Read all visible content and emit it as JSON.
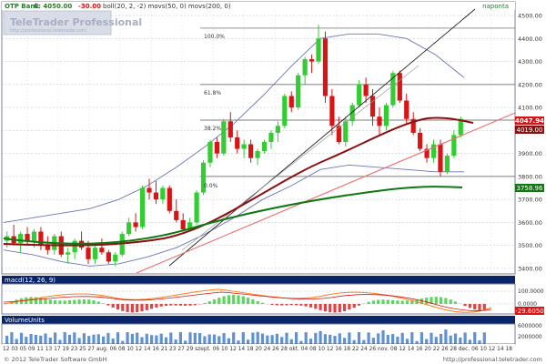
{
  "header": {
    "title": "OTP Bank",
    "close_label": "C: 4050.00",
    "change_label": "-30.00",
    "indicators_label": "boll(20, 2, -2)  movs(50, 0)  movs(200, 0)",
    "period": "naponta"
  },
  "watermark": {
    "name": "TeleTrader Professional",
    "url": "http://professional.teletrader.com"
  },
  "price_axis_ticks": [
    "4500.00",
    "4400.00",
    "4300.00",
    "4200.00",
    "4100.00",
    "4000.00",
    "3900.00",
    "3800.00",
    "3700.00",
    "3600.00",
    "3500.00",
    "3400.00"
  ],
  "price_badges": {
    "last": "4047.94",
    "ma50": "4019.00",
    "ma200": "3758.96"
  },
  "fib_labels": [
    "100.0%",
    "61.8%",
    "38.2%",
    "0.0%"
  ],
  "macd": {
    "title": "macd(12, 26, 9)",
    "ticks": [
      "100.0000",
      "0.0000"
    ],
    "badge": "-29.6050"
  },
  "volume": {
    "title": "VolumeUnits",
    "ticks": [
      "6000000",
      "2000000"
    ]
  },
  "x_axis_labels": "12 03 05 09 11 13 17 19 23 25 27 aug. 06 08 10 12 14 16 21 23 27 29 szept. 06 10 12 14 18 20 24 26 28 okt. 04 08 10 12 16 18 22 24 26 nov. 08 12 14 16 20 22 26 28 dec. 06 10 12 14 18",
  "footer": {
    "copyright": "© 2012 TeleTrader Software GmbH",
    "url": "http://professional.teletrader.com"
  },
  "colors": {
    "background": "#ffffff",
    "grid": "#b8bccd",
    "up": "#33cc33",
    "down": "#d81414",
    "ma50": "#8b1010",
    "ma200": "#107810",
    "panel_bar": "#0a246a"
  },
  "chart_data": {
    "type": "candlestick",
    "title": "OTP Bank",
    "ylim": [
      3380,
      4520
    ],
    "y_ticks": [
      4500,
      4400,
      4300,
      4200,
      4100,
      4000,
      3900,
      3800,
      3700,
      3600,
      3500,
      3400
    ],
    "candles_ohlc_sample": [
      [
        3520,
        3560,
        3490,
        3540
      ],
      [
        3540,
        3590,
        3500,
        3510
      ],
      [
        3510,
        3560,
        3470,
        3550
      ],
      [
        3550,
        3580,
        3500,
        3520
      ],
      [
        3520,
        3570,
        3490,
        3560
      ],
      [
        3560,
        3580,
        3480,
        3500
      ],
      [
        3500,
        3540,
        3460,
        3480
      ],
      [
        3480,
        3550,
        3460,
        3540
      ],
      [
        3540,
        3560,
        3450,
        3460
      ],
      [
        3460,
        3490,
        3420,
        3470
      ],
      [
        3470,
        3530,
        3440,
        3520
      ],
      [
        3520,
        3560,
        3480,
        3490
      ],
      [
        3490,
        3520,
        3420,
        3440
      ],
      [
        3440,
        3500,
        3420,
        3490
      ],
      [
        3490,
        3530,
        3460,
        3470
      ],
      [
        3470,
        3480,
        3420,
        3430
      ],
      [
        3430,
        3470,
        3410,
        3460
      ],
      [
        3460,
        3560,
        3450,
        3550
      ],
      [
        3550,
        3620,
        3540,
        3600
      ],
      [
        3600,
        3640,
        3560,
        3580
      ],
      [
        3580,
        3760,
        3570,
        3750
      ],
      [
        3750,
        3790,
        3700,
        3730
      ],
      [
        3730,
        3780,
        3680,
        3700
      ],
      [
        3700,
        3760,
        3680,
        3750
      ],
      [
        3750,
        3760,
        3640,
        3650
      ],
      [
        3650,
        3700,
        3600,
        3610
      ],
      [
        3610,
        3640,
        3560,
        3570
      ],
      [
        3570,
        3620,
        3560,
        3600
      ],
      [
        3600,
        3740,
        3590,
        3730
      ],
      [
        3730,
        3870,
        3720,
        3860
      ],
      [
        3860,
        3960,
        3840,
        3950
      ],
      [
        3950,
        3970,
        3880,
        3900
      ],
      [
        3900,
        4050,
        3890,
        4040
      ],
      [
        4040,
        4080,
        3950,
        3970
      ],
      [
        3970,
        4000,
        3900,
        3920
      ],
      [
        3920,
        3960,
        3880,
        3940
      ],
      [
        3940,
        3960,
        3860,
        3880
      ],
      [
        3880,
        3920,
        3850,
        3910
      ],
      [
        3910,
        3960,
        3900,
        3950
      ],
      [
        3950,
        4000,
        3920,
        3990
      ],
      [
        3990,
        4040,
        3950,
        4020
      ],
      [
        4020,
        4160,
        4010,
        4150
      ],
      [
        4150,
        4170,
        4080,
        4100
      ],
      [
        4100,
        4250,
        4090,
        4240
      ],
      [
        4240,
        4320,
        4200,
        4310
      ],
      [
        4310,
        4330,
        4250,
        4300
      ],
      [
        4300,
        4460,
        4290,
        4400
      ],
      [
        4400,
        4430,
        4120,
        4150
      ],
      [
        4150,
        4180,
        3980,
        4020
      ],
      [
        4020,
        4060,
        3940,
        3950
      ],
      [
        3950,
        4060,
        3930,
        4040
      ],
      [
        4040,
        4120,
        4020,
        4110
      ],
      [
        4110,
        4220,
        4100,
        4200
      ],
      [
        4200,
        4230,
        4120,
        4150
      ],
      [
        4150,
        4180,
        4020,
        4060
      ],
      [
        4060,
        4100,
        3980,
        4020
      ],
      [
        4020,
        4120,
        4000,
        4110
      ],
      [
        4110,
        4260,
        4100,
        4250
      ],
      [
        4250,
        4260,
        4120,
        4130
      ],
      [
        4130,
        4160,
        4030,
        4050
      ],
      [
        4050,
        4080,
        3980,
        3990
      ],
      [
        3990,
        4010,
        3910,
        3920
      ],
      [
        3920,
        3940,
        3860,
        3880
      ],
      [
        3880,
        3960,
        3860,
        3940
      ],
      [
        3940,
        3960,
        3800,
        3820
      ],
      [
        3820,
        3900,
        3810,
        3890
      ],
      [
        3890,
        4000,
        3880,
        3980
      ],
      [
        3980,
        4060,
        3970,
        4050
      ]
    ],
    "bollinger_upper_sample": [
      3600,
      3620,
      3640,
      3660,
      3700,
      3760,
      3840,
      3930,
      4030,
      4150,
      4280,
      4400,
      4420,
      4420,
      4400,
      4330,
      4230
    ],
    "bollinger_lower_sample": [
      3480,
      3460,
      3430,
      3410,
      3420,
      3450,
      3490,
      3550,
      3620,
      3700,
      3760,
      3830,
      3850,
      3840,
      3830,
      3820,
      3820
    ],
    "fibonacci_levels": [
      {
        "label": "100.0%",
        "value": 4445
      },
      {
        "label": "61.8%",
        "value": 4200
      },
      {
        "label": "38.2%",
        "value": 4045
      },
      {
        "label": "0.0%",
        "value": 3800
      }
    ],
    "macd_ylim": [
      -60,
      110
    ]
  }
}
